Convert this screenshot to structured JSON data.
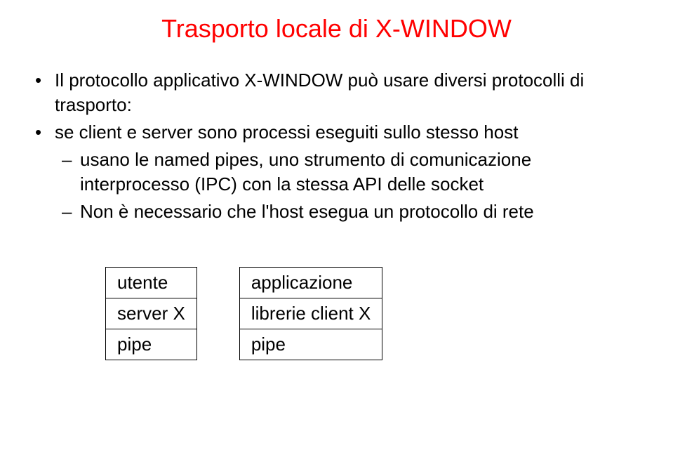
{
  "title": "Trasporto locale di X-WINDOW",
  "bullets": [
    {
      "text": "Il protocollo applicativo X-WINDOW può usare diversi protocolli di trasporto:"
    },
    {
      "text": "se client e server sono processi eseguiti sullo stesso host",
      "subs": [
        "usano le named pipes, uno strumento di comunicazione interprocesso (IPC) con la stessa API delle socket",
        "Non è necessario che l'host esegua un protocollo di rete"
      ]
    }
  ],
  "table_left": {
    "rows": [
      "utente",
      "server X",
      "pipe"
    ]
  },
  "table_right": {
    "rows": [
      "applicazione",
      "librerie client X",
      "pipe"
    ]
  }
}
